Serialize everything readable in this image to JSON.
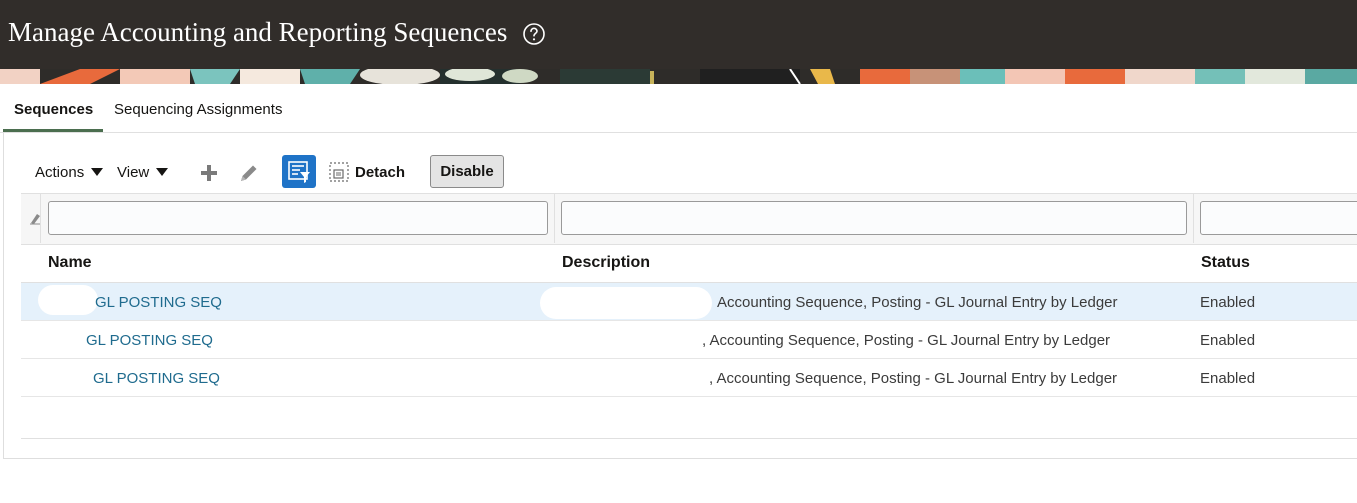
{
  "page": {
    "title": "Manage Accounting and Reporting Sequences",
    "help_icon": "question-circle-icon"
  },
  "tabs": [
    {
      "label": "Sequences",
      "selected": true
    },
    {
      "label": "Sequencing Assignments",
      "selected": false
    }
  ],
  "toolbar": {
    "actions_label": "Actions",
    "view_label": "View",
    "add_icon": "plus-icon",
    "edit_icon": "pencil-icon",
    "filter_icon": "query-by-example-icon",
    "detach_icon": "detach-icon",
    "detach_label": "Detach",
    "disable_label": "Disable"
  },
  "table": {
    "filters": {
      "name": "",
      "description": "",
      "status": ""
    },
    "columns": [
      "Name",
      "Description",
      "Status"
    ],
    "rows": [
      {
        "name": "GL POSTING SEQ",
        "description": "Accounting Sequence, Posting - GL Journal Entry by Ledger",
        "status": "Enabled",
        "selected": true
      },
      {
        "name": "GL POSTING SEQ",
        "description": ", Accounting Sequence, Posting - GL Journal Entry by Ledger",
        "status": "Enabled",
        "selected": false
      },
      {
        "name": "GL POSTING SEQ",
        "description": ", Accounting Sequence, Posting - GL Journal Entry by Ledger",
        "status": "Enabled",
        "selected": false
      }
    ]
  },
  "colors": {
    "header_bg": "#312d2a",
    "tab_underline": "#4b6e4f",
    "link": "#1f6b8e",
    "selected_row": "#e5f1fb",
    "qbe_button": "#1f73c7"
  }
}
